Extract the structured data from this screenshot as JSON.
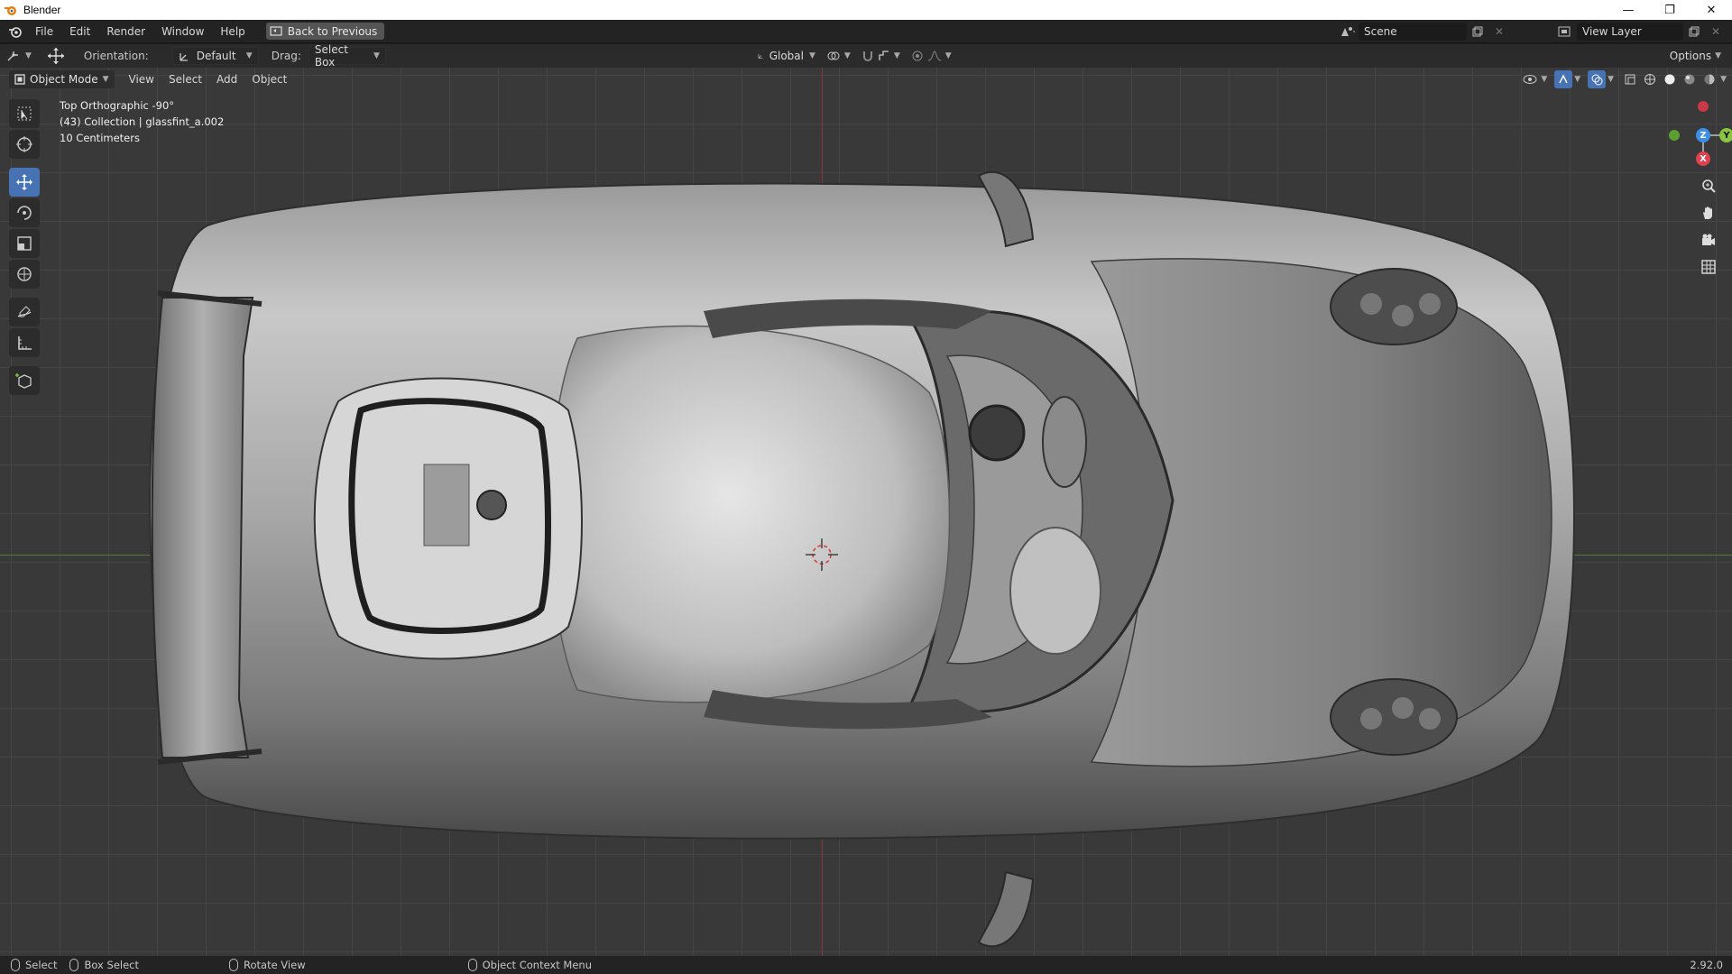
{
  "window": {
    "title": "Blender"
  },
  "menubar": {
    "items": [
      "File",
      "Edit",
      "Render",
      "Window",
      "Help"
    ],
    "back_button": "Back to Previous",
    "scene": "Scene",
    "view_layer": "View Layer"
  },
  "toolheader": {
    "orientation_label": "Orientation:",
    "orientation_value": "Default",
    "drag_label": "Drag:",
    "drag_value": "Select Box",
    "transform_orientation": "Global",
    "options": "Options"
  },
  "viewheader": {
    "mode": "Object Mode",
    "menus": [
      "View",
      "Select",
      "Add",
      "Object"
    ]
  },
  "viewport": {
    "view_name": "Top Orthographic -90°",
    "collection_info": "(43) Collection | glassfint_a.002",
    "scale_info": "10 Centimeters"
  },
  "gizmo": {
    "z": "Z",
    "y": "Y",
    "x": "X"
  },
  "statusbar": {
    "select": "Select",
    "box_select": "Box Select",
    "rotate_view": "Rotate View",
    "context_menu": "Object Context Menu",
    "version": "2.92.0"
  },
  "colors": {
    "accent": "#4772b3",
    "axis_x": "#e0404f",
    "axis_y": "#8bc53f",
    "axis_z": "#3d8ee8"
  }
}
